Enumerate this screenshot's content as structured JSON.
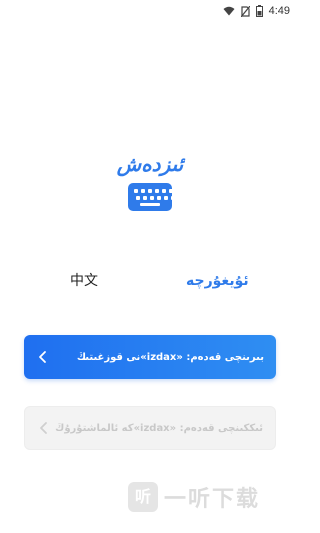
{
  "status_bar": {
    "time": "4:49",
    "icons": [
      "wifi-icon",
      "no-sim-icon",
      "battery-icon"
    ]
  },
  "brand": {
    "name": "ئىزدەش",
    "accent_color": "#2f7bea",
    "icon": "keyboard-icon"
  },
  "languages": {
    "chinese_label": "中文",
    "uyghur_label": "ئۇيغۇرچە",
    "selected": "uyghur"
  },
  "steps": {
    "step1_label": "بىرىنچى قەدەم: «izdax»نى قوزغىتىڭ",
    "step2_label": "ئىككىنچى قەدەم: «izdax»كە ئالماشتۇرۇڭ",
    "chevron_icon": "chevron-left-icon"
  },
  "watermark": {
    "badge": "听",
    "text": "一听下载"
  }
}
